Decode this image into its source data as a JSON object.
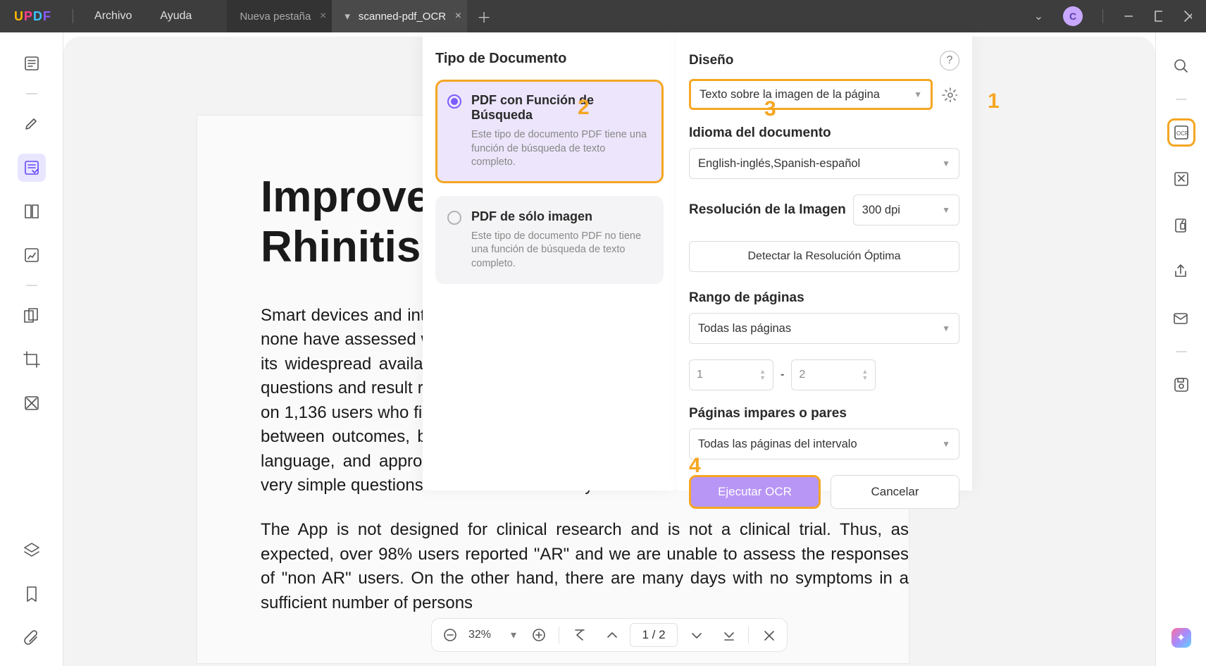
{
  "menubar": {
    "logo": "UPDF",
    "menus": {
      "file": "Archivo",
      "help": "Ayuda"
    },
    "tabs": {
      "inactive": "Nueva pestaña",
      "active": "scanned-pdf_OCR"
    },
    "avatar_initial": "C"
  },
  "document": {
    "heading": "Improve Work Productivity in Rhinitis",
    "p1": "Smart devices and internet-based applications are already used in rhinitis (24-27), but none have assessed work productivity. The strengths of this mobile technology include its widespread availability and easy use, but there is a need to identify appropriate questions and result reliability as assessed by pilot studies. This pilot study was based on 1,136 users who filled in 5,870 days using VAS allowing us to perform comparisons between outcomes, but not to make subgroup analyses (12). We collected country, language, and approximate date of entry of information with geolocation. We used very simple questions translated or culturally translated into 15 languages.",
    "p2": "The App is not designed for clinical research and is not a clinical trial. Thus, as expected, over 98% users reported \"AR\" and we are unable to assess the responses of \"non AR\" users. On the other hand, there are many days with no symptoms in a sufficient number of persons"
  },
  "pagebar": {
    "zoom": "32%",
    "page_current": "1",
    "page_total": "2"
  },
  "ocr_panel": {
    "doc_type_heading": "Tipo de Documento",
    "opt1_title": "PDF con Función de Búsqueda",
    "opt1_desc": "Este tipo de documento PDF tiene una función de búsqueda de texto completo.",
    "opt2_title": "PDF de sólo imagen",
    "opt2_desc": "Este tipo de documento PDF no tiene una función de búsqueda de texto completo.",
    "design_label": "Diseño",
    "design_value": "Texto sobre la imagen de la página",
    "lang_label": "Idioma del documento",
    "lang_value": "English-inglés,Spanish-español",
    "res_label": "Resolución de la Imagen",
    "res_value": "300 dpi",
    "detect_btn": "Detectar la Resolución Óptima",
    "range_label": "Rango de páginas",
    "range_value": "Todas las páginas",
    "range_from": "1",
    "range_sep": "-",
    "range_to": "2",
    "oddeven_label": "Páginas impares o pares",
    "oddeven_value": "Todas las páginas del intervalo",
    "run_btn": "Ejecutar OCR",
    "cancel_btn": "Cancelar"
  },
  "annotations": {
    "a1": "1",
    "a2": "2",
    "a3": "3",
    "a4": "4"
  }
}
